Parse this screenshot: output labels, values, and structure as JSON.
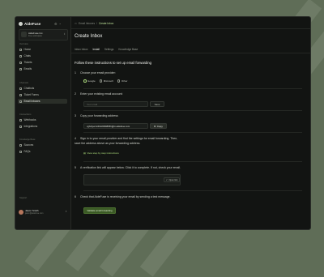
{
  "app": {
    "name": "AideFuse"
  },
  "org": {
    "name": "AideFuse Inc.",
    "sub": "Free workspace"
  },
  "sidebar": {
    "sections": [
      {
        "title": "Overview",
        "items": [
          {
            "label": "Home"
          },
          {
            "label": "Chats"
          },
          {
            "label": "Tickets"
          },
          {
            "label": "Emails"
          }
        ]
      },
      {
        "title": "Channels",
        "items": [
          {
            "label": "Chatbots"
          },
          {
            "label": "Ticket Forms"
          },
          {
            "label": "Email Inboxes",
            "active": true
          }
        ]
      },
      {
        "title": "Connections",
        "items": [
          {
            "label": "Webhooks"
          },
          {
            "label": "Integrations"
          }
        ]
      },
      {
        "title": "Knowledge Base",
        "items": [
          {
            "label": "Sources"
          },
          {
            "label": "FAQs"
          }
        ]
      }
    ],
    "bottom_section": "Support"
  },
  "user": {
    "name": "Jason Smith",
    "email": "jason@aidefuse.com"
  },
  "breadcrumb": {
    "parent": "Email Inboxes",
    "sep": "/",
    "current": "Create Inbox"
  },
  "page": {
    "title": "Create Inbox",
    "tabs": [
      {
        "label": "Inbox Inbox"
      },
      {
        "label": "Install",
        "active": true
      },
      {
        "label": "Settings"
      },
      {
        "label": "Knowledge Base"
      }
    ],
    "intro": "Follow these instructions to set up email forwarding"
  },
  "steps": {
    "s1": {
      "num": "1",
      "text": "Choose your email provider:",
      "options": [
        "Google",
        "Microsoft",
        "Other"
      ],
      "selected": "Google"
    },
    "s2": {
      "num": "2",
      "text": "Enter your existing email account:",
      "placeholder": "Your email",
      "button": "Save"
    },
    "s3": {
      "num": "3",
      "text": "Copy your forwarding address",
      "value": "vgbsfyervtr4hd2399835h@in.aidefuse.com",
      "button": "Copy"
    },
    "s4": {
      "num": "4",
      "text": "Sign in to your email provider and find the settings for email forwarding. Then, save the address above as your forwarding address.",
      "link": "View step by step instructions"
    },
    "s5": {
      "num": "5",
      "text": "A verification link will appear below. Click it to complete. If not, check your email.",
      "button": "Open link"
    },
    "s6": {
      "num": "6",
      "text": "Check that AideFuse is receiving your email by sending a test message.",
      "button": "Validate email forwarding"
    }
  },
  "colors": {
    "accent": "#a9d87a",
    "background": "#5f6d57",
    "window": "#121412"
  }
}
